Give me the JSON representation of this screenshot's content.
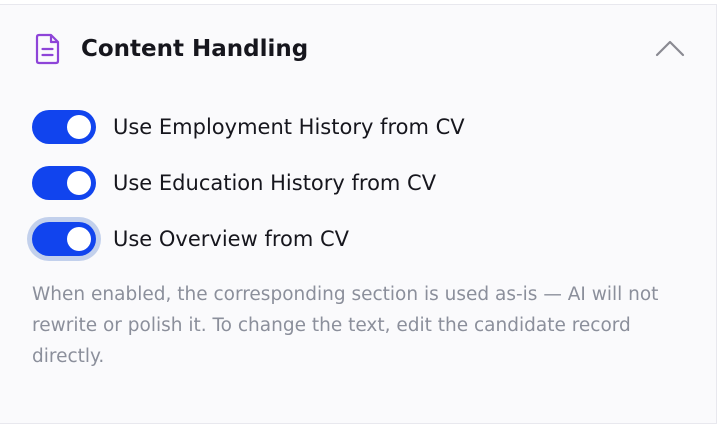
{
  "section": {
    "title": "Content Handling",
    "icon": "document-icon",
    "collapse_icon": "chevron-up-icon",
    "expanded": true
  },
  "toggles": [
    {
      "label": "Use Employment History from CV",
      "checked": true
    },
    {
      "label": "Use Education History from CV",
      "checked": true
    },
    {
      "label": "Use Overview from CV",
      "checked": true,
      "focused": true
    }
  ],
  "help_text": "When enabled, the corresponding section is used as-is — AI will not rewrite or polish it. To change the text, edit the candidate record directly.",
  "colors": {
    "accent": "#1144ee",
    "icon": "#8e44d8",
    "title": "#16161d",
    "help": "#8b8f9b",
    "panel_bg": "#fafafc"
  }
}
